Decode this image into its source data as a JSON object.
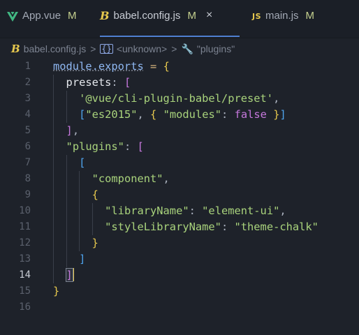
{
  "tabs": [
    {
      "name": "App.vue",
      "status": "M",
      "icon": "vue-icon",
      "active": false
    },
    {
      "name": "babel.config.js",
      "status": "M",
      "icon": "babel-icon",
      "active": true,
      "close": "×"
    },
    {
      "name": "main.js",
      "status": "M",
      "icon": "js-icon",
      "active": false,
      "icon_text": "JS"
    }
  ],
  "breadcrumb": {
    "file": "babel.config.js",
    "symbol": "<unknown>",
    "property": "\"plugins\"",
    "separator": ">"
  },
  "editor": {
    "current_line": 14,
    "line_numbers": [
      "1",
      "2",
      "3",
      "4",
      "5",
      "6",
      "7",
      "8",
      "9",
      "10",
      "11",
      "12",
      "13",
      "14",
      "15",
      "16"
    ],
    "lines": [
      "module.exports = {",
      "  presets: [",
      "    '@vue/cli-plugin-babel/preset',",
      "    [\"es2015\", { \"modules\": false }]",
      "  ],",
      "  \"plugins\": [",
      "    [",
      "      \"component\",",
      "      {",
      "        \"libraryName\": \"element-ui\",",
      "        \"styleLibraryName\": \"theme-chalk\"",
      "      }",
      "    ]",
      "  ]",
      "}",
      ""
    ]
  },
  "colors": {
    "background": "#1e222a",
    "tab_accent": "#4f7fd0",
    "string": "#a9d37c",
    "bracket_purple": "#c678dd",
    "bracket_blue": "#4fa3ec",
    "brace_yellow": "#e6c84e"
  }
}
